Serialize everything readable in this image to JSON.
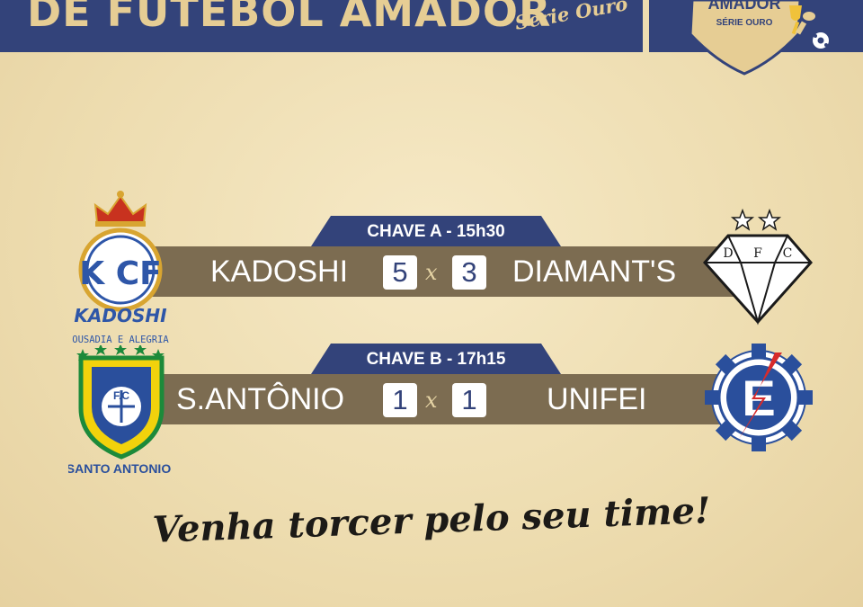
{
  "header": {
    "title": "DE FUTEBOL AMADOR",
    "series": "Série Ouro",
    "badge_title": "AMADOR",
    "badge_series": "SÉRIE OURO"
  },
  "matches": [
    {
      "group": "CHAVE A - 15h30",
      "home_team": "KADOSHI",
      "home_score": "5",
      "separator": "x",
      "away_score": "3",
      "away_team": "DIAMANT'S"
    },
    {
      "group": "CHAVE B - 17h15",
      "home_team": "S.ANTÔNIO",
      "home_score": "1",
      "separator": "x",
      "away_score": "1",
      "away_team": "UNIFEI"
    }
  ],
  "crests": {
    "kadoshi": {
      "name": "KADOSHI",
      "motto": "OUSADIA E ALEGRIA",
      "monogram": "K CF"
    },
    "diamants": {
      "letters": [
        "D",
        "F",
        "C"
      ]
    },
    "santo_antonio": {
      "initials": "F.C",
      "name": "SANTO ANTONIO"
    },
    "unifei": {
      "letter": "E"
    }
  },
  "tagline": "Venha torcer pelo seu time!",
  "colors": {
    "navy": "#33437a",
    "gold": "#e6cd94",
    "bar": "#7c6c51",
    "background": "#f1e2b9"
  }
}
